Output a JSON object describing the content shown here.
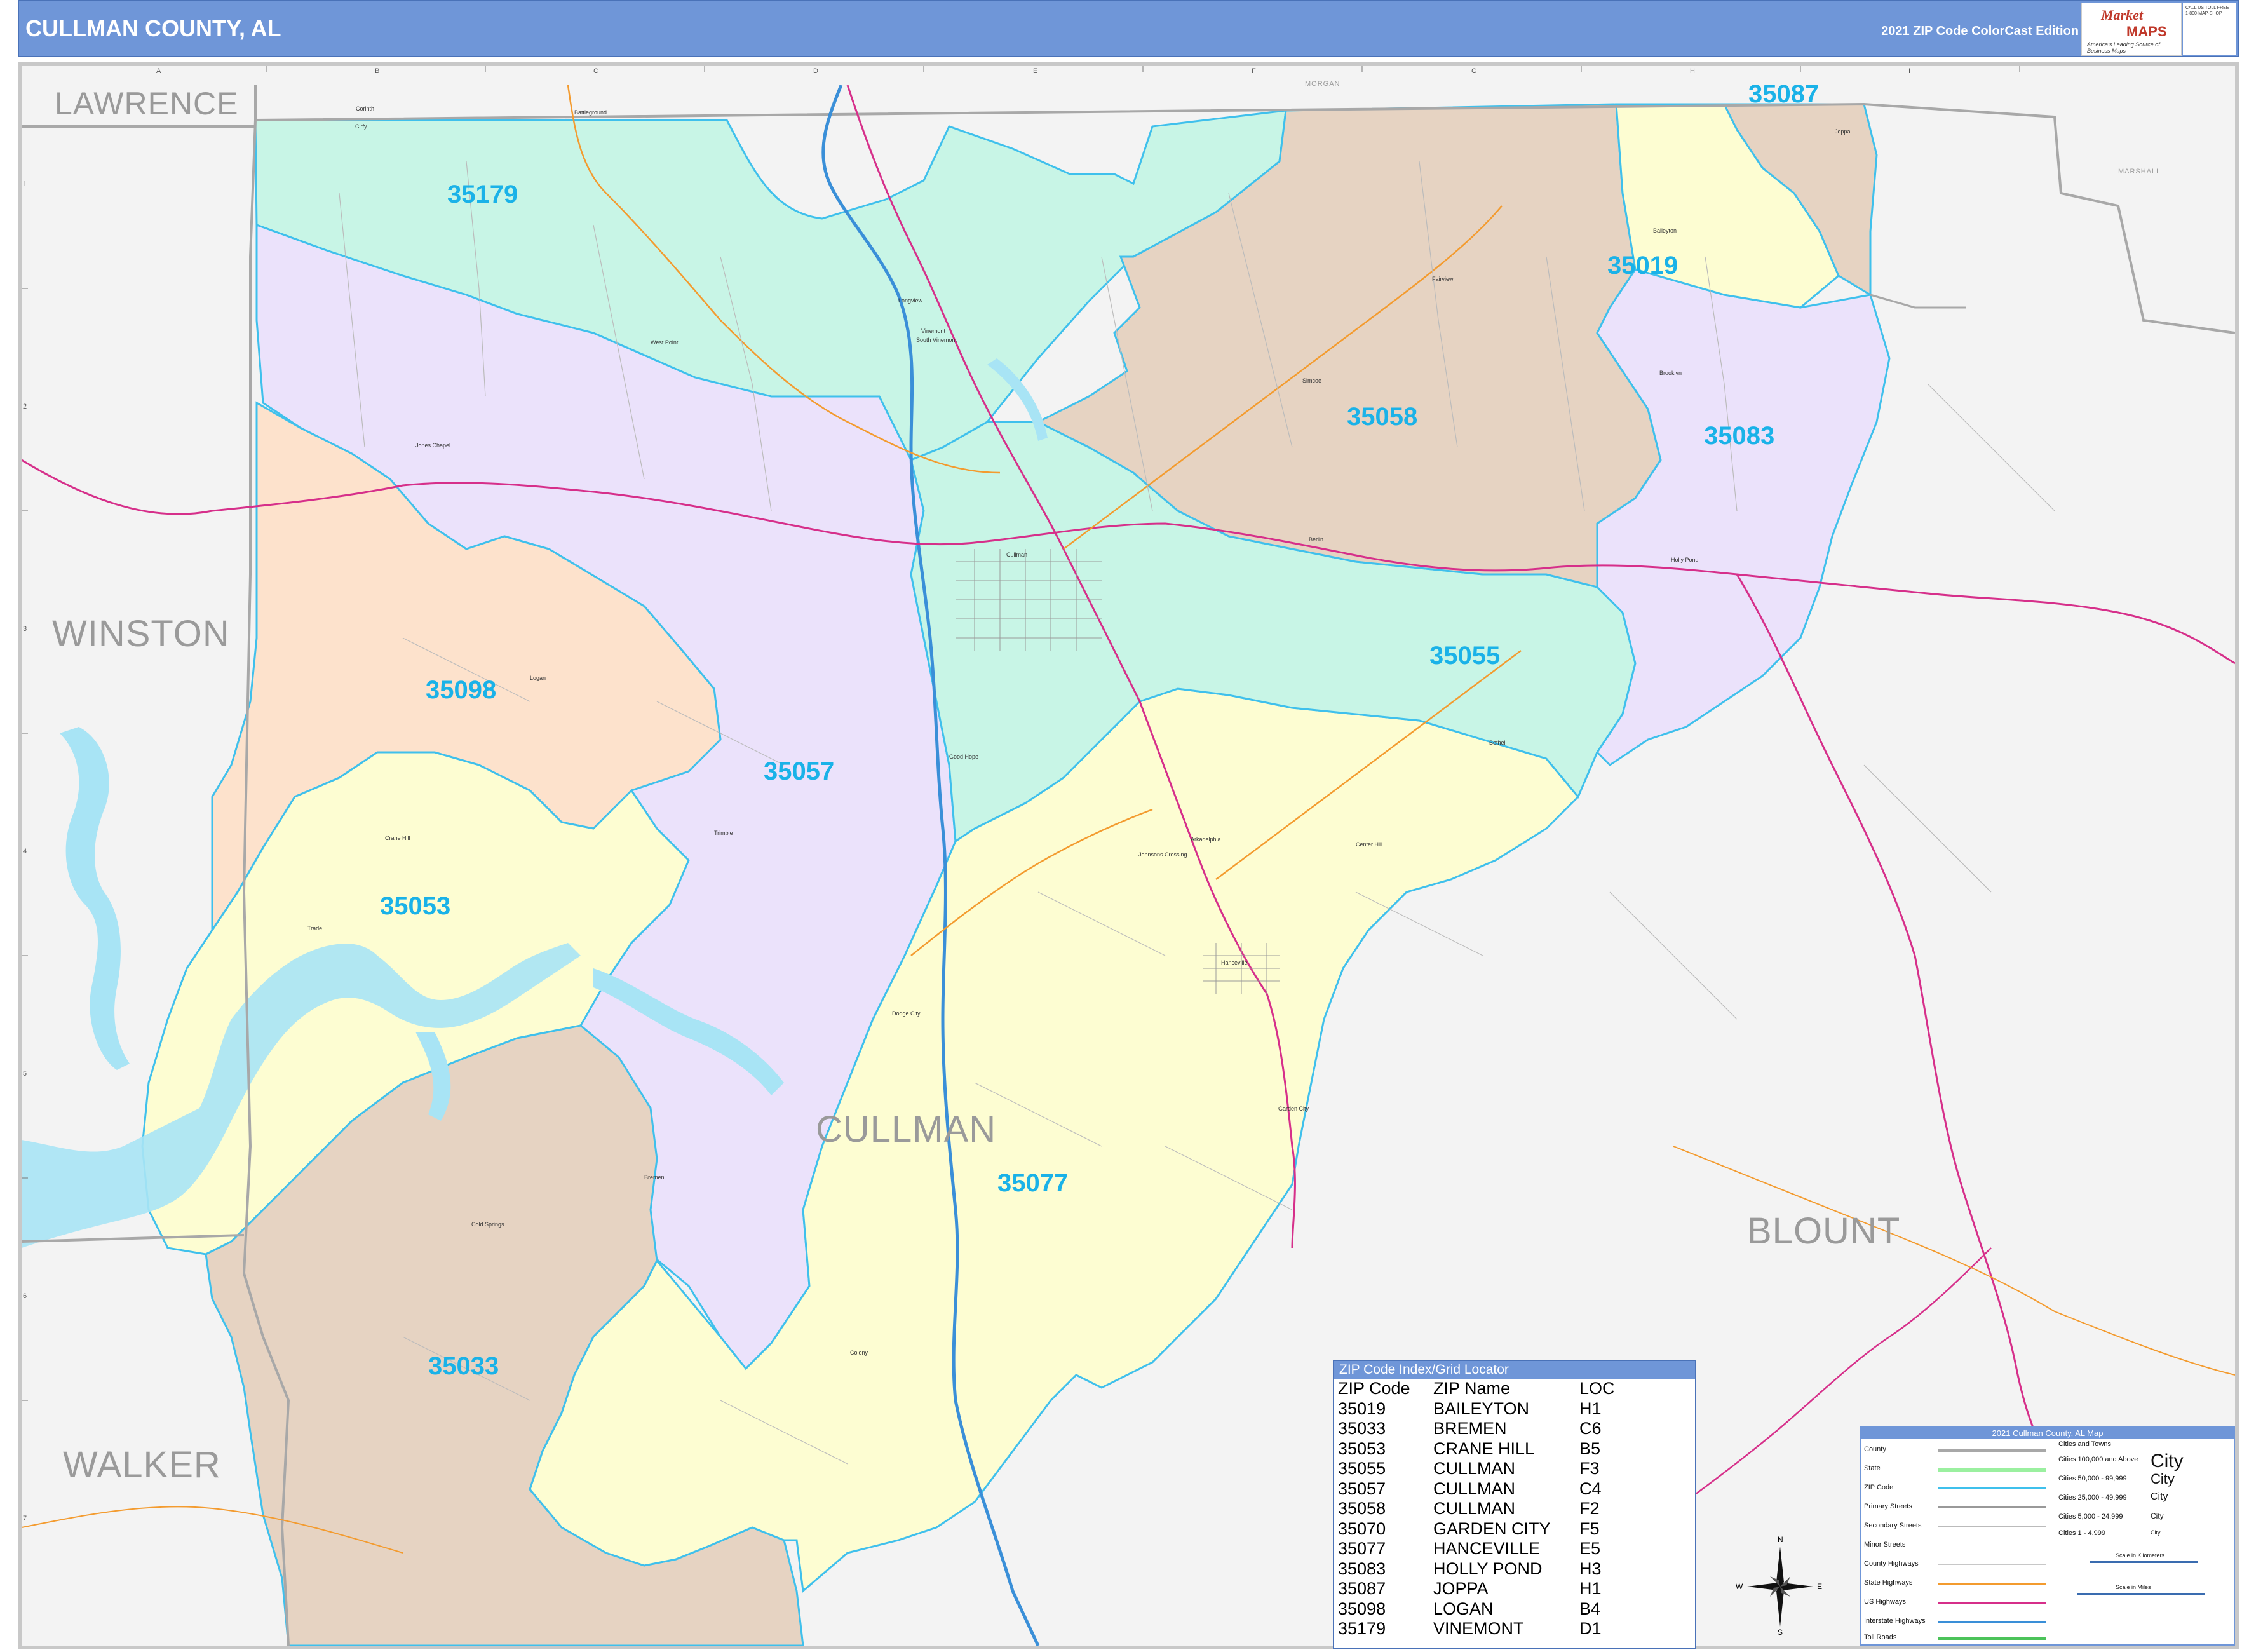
{
  "header": {
    "title": "CULLMAN COUNTY, AL",
    "edition": "2021 ZIP Code ColorCast Edition",
    "logo_line1": "Market",
    "logo_line2": "MAPS",
    "logo_tagline": "America's Leading Source of Business Maps",
    "contact": "CALL US TOLL FREE 1-800-MAP-SHOP"
  },
  "counties": {
    "lawrence": "LAWRENCE",
    "winston": "WINSTON",
    "walker": "WALKER",
    "blount": "BLOUNT",
    "cullman": "CULLMAN",
    "marshall": "MARSHALL",
    "morgan": "MORGAN"
  },
  "zip_labels": {
    "z35179": "35179",
    "z35087": "35087",
    "z35019": "35019",
    "z35058": "35058",
    "z35083": "35083",
    "z35055": "35055",
    "z35098": "35098",
    "z35057": "35057",
    "z35053": "35053",
    "z35077": "35077",
    "z35033": "35033"
  },
  "cities": {
    "battleground": "Battleground",
    "joppa": "Joppa",
    "baileyton": "Baileyton",
    "fairview": "Fairview",
    "longview": "Longview",
    "vinemont": "Vinemont",
    "south_vinemont": "South Vinemont",
    "west_point": "West Point",
    "simcoe": "Simcoe",
    "brooklyn": "Brooklyn",
    "jones_chapel": "Jones Chapel",
    "cullman": "Cullman",
    "berlin": "Berlin",
    "holly_pond": "Holly Pond",
    "logan": "Logan",
    "good_hope": "Good Hope",
    "baileyton2": "Bethel",
    "crane_hill": "Crane Hill",
    "trimble": "Trimble",
    "johnsons_crossing": "Johnsons Crossing",
    "arkadelphia": "Arkadelphia",
    "center_hill": "Center Hill",
    "hanceville": "Hanceville",
    "dodge_city": "Dodge City",
    "garden_city": "Garden City",
    "bremen": "Bremen",
    "cold_springs": "Cold Springs",
    "colony": "Colony",
    "trade": "Trade",
    "corinth": "Corinth",
    "cirfy": "Cirfy"
  },
  "grid": {
    "cols": [
      "A",
      "B",
      "C",
      "D",
      "E",
      "F",
      "G",
      "H",
      "I"
    ],
    "rows": [
      "1",
      "2",
      "3",
      "4",
      "5",
      "6",
      "7"
    ]
  },
  "zip_index": {
    "title": "ZIP Code Index/Grid Locator",
    "headers": [
      "ZIP Code",
      "ZIP Name",
      "LOC"
    ],
    "rows": [
      [
        "35019",
        "BAILEYTON",
        "H1"
      ],
      [
        "35033",
        "BREMEN",
        "C6"
      ],
      [
        "35053",
        "CRANE HILL",
        "B5"
      ],
      [
        "35055",
        "CULLMAN",
        "F3"
      ],
      [
        "35057",
        "CULLMAN",
        "C4"
      ],
      [
        "35058",
        "CULLMAN",
        "F2"
      ],
      [
        "35070",
        "GARDEN CITY",
        "F5"
      ],
      [
        "35077",
        "HANCEVILLE",
        "E5"
      ],
      [
        "35083",
        "HOLLY POND",
        "H3"
      ],
      [
        "35087",
        "JOPPA",
        "H1"
      ],
      [
        "35098",
        "LOGAN",
        "B4"
      ],
      [
        "35179",
        "VINEMONT",
        "D1"
      ]
    ]
  },
  "legend": {
    "title": "2021 Cullman County, AL Map",
    "items": [
      "County",
      "State",
      "ZIP Code",
      "Primary Streets",
      "Secondary Streets",
      "Minor Streets",
      "County Highways",
      "State Highways",
      "US Highways",
      "Interstate Highways",
      "Toll Roads"
    ],
    "cities_title": "Cities and Towns",
    "city_tiers": [
      "Cities 100,000 and Above",
      "Cities 50,000 - 99,999",
      "Cities 25,000 - 49,999",
      "Cities 5,000 - 24,999",
      "Cities 1 - 4,999"
    ],
    "city_samples": [
      "City",
      "City",
      "City",
      "City",
      "City"
    ],
    "scale_km": "Scale in Kilometers",
    "scale_mi": "Scale in Miles"
  },
  "compass": {
    "n": "N",
    "s": "S",
    "e": "E",
    "w": "W"
  },
  "colors": {
    "green": "#c8f5e6",
    "lavender": "#ebe2fb",
    "tan": "#e6d3c2",
    "yellow": "#fdfdd2",
    "peach": "#fde2cc",
    "water": "#a8e4f5",
    "zip_border": "#3fc0ec",
    "outside": "#f3f3f3"
  }
}
